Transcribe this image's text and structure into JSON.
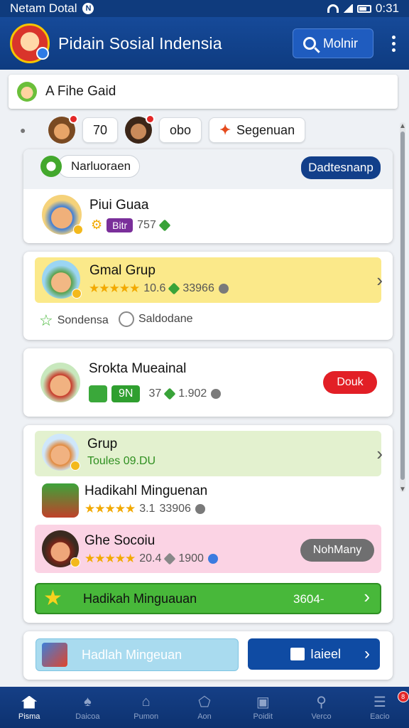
{
  "status_bar": {
    "carrier": "Netam Dotal",
    "time": "0:31"
  },
  "header": {
    "title": "Pidain Sosial Indensia",
    "search_label": "Molnir"
  },
  "filter": {
    "text": "A Fihe Gaid"
  },
  "chips": {
    "count_a": "70",
    "count_b": "obo",
    "segment_label": "Segenuan"
  },
  "card1": {
    "group_label": "Narluoraen",
    "action_label": "Dadtesnanp",
    "name": "Piui Guaa",
    "tag": "Bitr",
    "score": "757"
  },
  "card2": {
    "name": "Gmal Grup",
    "rating": "10.6",
    "count": "33966",
    "footer_a": "Sondensa",
    "footer_b": "Saldodane"
  },
  "card3": {
    "name": "Srokta Mueainal",
    "badge": "9N",
    "score": "37",
    "count": "1.902",
    "action_label": "Douk"
  },
  "card4": {
    "group_name": "Grup",
    "group_sub": "Toules 09.DU",
    "item2_name": "Hadikahl Minguenan",
    "item2_rating": "3.1",
    "item2_count": "33906",
    "item3_name": "Ghe Socoiu",
    "item3_rating": "20.4",
    "item3_count": "1900",
    "item3_action": "NohMany",
    "green_label": "Hadikah Minguauan",
    "green_value": "3604-"
  },
  "card5": {
    "left_label": "Hadlah Mingeuan",
    "right_label": "Iaieel"
  },
  "nav": [
    {
      "label": "Pisma"
    },
    {
      "label": "Daicoa"
    },
    {
      "label": "Pumon"
    },
    {
      "label": "Aon"
    },
    {
      "label": "Poidit"
    },
    {
      "label": "Verco"
    },
    {
      "label": "Eacio",
      "badge": "8"
    }
  ],
  "colors": {
    "primary": "#0f3b7d",
    "accent_red": "#e21f26",
    "star": "#f2a900",
    "green": "#48b83a"
  }
}
